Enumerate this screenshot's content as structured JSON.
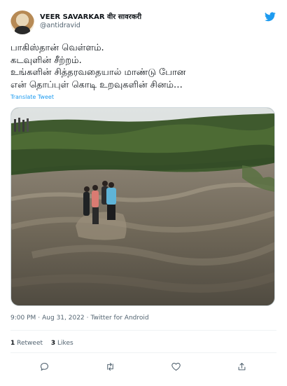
{
  "author": {
    "display_name": "VEER SAVARKAR वीर सावरकरी",
    "handle": "@antidravid"
  },
  "tweet": {
    "lines": [
      "பாகிஸ்தான் வெள்ளம்.",
      "கடவுளின் சீற்றம்.",
      "உங்களின் சித்தரவதையால் மாண்டு போன",
      "என் தொப்புள் கொடி உறவுகளின் சினம்…"
    ],
    "translate_label": "Translate Tweet"
  },
  "meta": {
    "time": "9:00 PM",
    "date": "Aug 31, 2022",
    "source": "Twitter for Android",
    "separator": "·"
  },
  "stats": {
    "retweets_count": "1",
    "retweets_label": "Retweet",
    "likes_count": "3",
    "likes_label": "Likes"
  },
  "icons": {
    "brand": "twitter-bird-icon",
    "reply": "reply-icon",
    "retweet": "retweet-icon",
    "like": "heart-icon",
    "share": "share-icon"
  },
  "colors": {
    "accent": "#1d9bf0",
    "secondary_text": "#536471",
    "primary_text": "#0f1419"
  }
}
